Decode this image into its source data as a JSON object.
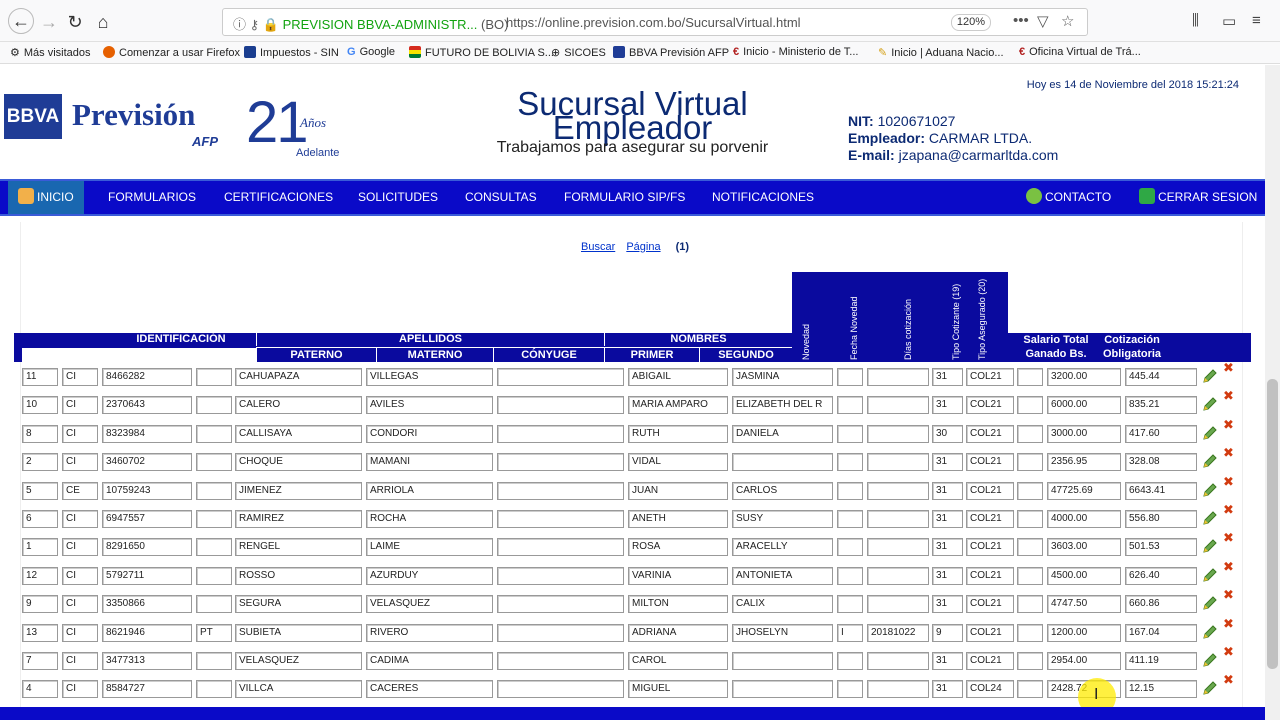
{
  "browser": {
    "site_name": "PREVISION BBVA-ADMINISTR...",
    "site_country": "(BO)",
    "url": "https://online.prevision.com.bo/SucursalVirtual.html",
    "zoom": "120%"
  },
  "bookmarks": [
    {
      "label": "Más visitados",
      "color": "#666"
    },
    {
      "label": "Comenzar a usar Firefox",
      "color": "#e66000"
    },
    {
      "label": "Impuestos - SIN",
      "color": "#1a3d8f"
    },
    {
      "label": "Google",
      "color": "#4285f4"
    },
    {
      "label": "FUTURO DE BOLIVIA S...",
      "color": "#c0392b"
    },
    {
      "label": "SICOES",
      "color": "#555"
    },
    {
      "label": "BBVA Previsión AFP",
      "color": "#1f3c96"
    },
    {
      "label": "Inicio - Ministerio de T...",
      "color": "#b22222"
    },
    {
      "label": "Inicio | Aduana Nacio...",
      "color": "#d4a017"
    },
    {
      "label": "Oficina Virtual de Trá...",
      "color": "#b22222"
    }
  ],
  "header": {
    "logo_bank": "BBVA",
    "logo_name": "Previsión",
    "logo_afp": "AFP",
    "logo_years": "21",
    "logo_anos": "Años",
    "logo_adelante": "Adelante",
    "title_line1": "Sucursal Virtual",
    "title_line2": "Empleador",
    "subtitle": "Trabajamos para asegurar su porvenir",
    "date_text": "Hoy es 14 de Noviembre del 2018 15:21:24",
    "nit_label": "NIT:",
    "nit_value": "1020671027",
    "employer_label": "Empleador:",
    "employer_value": "CARMAR LTDA.",
    "email_label": "E-mail:",
    "email_value": "jzapana@carmarltda.com"
  },
  "menu": {
    "inicio": "INICIO",
    "formularios": "FORMULARIOS",
    "certificaciones": "CERTIFICACIONES",
    "solicitudes": "SOLICITUDES",
    "consultas": "CONSULTAS",
    "formulario_sip": "FORMULARIO SIP/FS",
    "notificaciones": "NOTIFICACIONES",
    "contacto": "CONTACTO",
    "cerrar": "CERRAR SESION"
  },
  "pager": {
    "buscar": "Buscar",
    "pagina": "Página",
    "current": "(1)"
  },
  "table_headers": {
    "identificacion": "IDENTIFICACIÓN",
    "apellidos": "APELLIDOS",
    "paterno": "PATERNO",
    "materno": "MATERNO",
    "conyuge": "CÓNYUGE",
    "nombres": "NOMBRES",
    "primer": "PRIMER",
    "segundo": "SEGUNDO",
    "novedad": "Novedad",
    "fecha_novedad": "Fecha Novedad",
    "dias_cotizacion": "Días cotización",
    "tipo_cotizante": "Tipo Cotizante (19)",
    "tipo_asegurado": "Tipo Asegurado (20)",
    "salario_1": "Salario Total",
    "salario_2": "Ganado Bs.",
    "cotizacion_1": "Cotización",
    "cotizacion_2": "Obligatoria"
  },
  "rows": [
    [
      "11",
      "CI",
      "8466282",
      "",
      "CAHUAPAZA",
      "VILLEGAS",
      "",
      "ABIGAIL",
      "JASMINA",
      "",
      "",
      "31",
      "COL21",
      "",
      "3200.00",
      "445.44"
    ],
    [
      "10",
      "CI",
      "2370643",
      "",
      "CALERO",
      "AVILES",
      "",
      "MARIA AMPARO",
      "ELIZABETH DEL R",
      "",
      "",
      "31",
      "COL21",
      "",
      "6000.00",
      "835.21"
    ],
    [
      "8",
      "CI",
      "8323984",
      "",
      "CALLISAYA",
      "CONDORI",
      "",
      "RUTH",
      "DANIELA",
      "",
      "",
      "30",
      "COL21",
      "",
      "3000.00",
      "417.60"
    ],
    [
      "2",
      "CI",
      "3460702",
      "",
      "CHOQUE",
      "MAMANI",
      "",
      "VIDAL",
      "",
      "",
      "",
      "31",
      "COL21",
      "",
      "2356.95",
      "328.08"
    ],
    [
      "5",
      "CE",
      "10759243",
      "",
      "JIMENEZ",
      "ARRIOLA",
      "",
      "JUAN",
      "CARLOS",
      "",
      "",
      "31",
      "COL21",
      "",
      "47725.69",
      "6643.41"
    ],
    [
      "6",
      "CI",
      "6947557",
      "",
      "RAMIREZ",
      "ROCHA",
      "",
      "ANETH",
      "SUSY",
      "",
      "",
      "31",
      "COL21",
      "",
      "4000.00",
      "556.80"
    ],
    [
      "1",
      "CI",
      "8291650",
      "",
      "RENGEL",
      "LAIME",
      "",
      "ROSA",
      "ARACELLY",
      "",
      "",
      "31",
      "COL21",
      "",
      "3603.00",
      "501.53"
    ],
    [
      "12",
      "CI",
      "5792711",
      "",
      "ROSSO",
      "AZURDUY",
      "",
      "VARINIA",
      "ANTONIETA",
      "",
      "",
      "31",
      "COL21",
      "",
      "4500.00",
      "626.40"
    ],
    [
      "9",
      "CI",
      "3350866",
      "",
      "SEGURA",
      "VELASQUEZ",
      "",
      "MILTON",
      "CALIX",
      "",
      "",
      "31",
      "COL21",
      "",
      "4747.50",
      "660.86"
    ],
    [
      "13",
      "CI",
      "8621946",
      "PT",
      "SUBIETA",
      "RIVERO",
      "",
      "ADRIANA",
      "JHOSELYN",
      "I",
      "20181022",
      "9",
      "COL21",
      "",
      "1200.00",
      "167.04"
    ],
    [
      "7",
      "CI",
      "3477313",
      "",
      "VELASQUEZ",
      "CADIMA",
      "",
      "CAROL",
      "",
      "",
      "",
      "31",
      "COL21",
      "",
      "2954.00",
      "411.19"
    ],
    [
      "4",
      "CI",
      "8584727",
      "",
      "VILLCA",
      "CACERES",
      "",
      "MIGUEL",
      "",
      "",
      "",
      "31",
      "COL24",
      "",
      "2428.72",
      "12.15"
    ]
  ],
  "colors": {
    "menu_bg": "#0a0ac8",
    "header_blue": "#0a0a9e",
    "brand_blue": "#1f3c96",
    "secure_green": "#12a30f",
    "delete_red": "#d23b10"
  }
}
